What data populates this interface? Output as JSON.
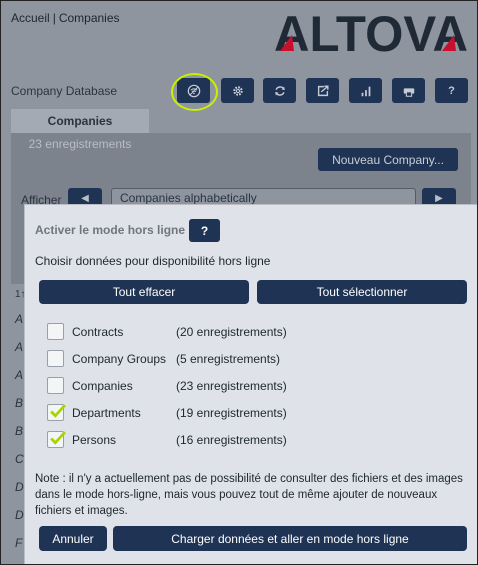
{
  "breadcrumb": {
    "home": "Accueil",
    "separator": "|",
    "current": "Companies"
  },
  "logo": {
    "text": "ALTOVA",
    "accent_color": "#c8102e"
  },
  "page": {
    "title": "Company Database"
  },
  "toolbar": {
    "buttons": [
      {
        "icon": "offline-icon"
      },
      {
        "icon": "gear-icon"
      },
      {
        "icon": "refresh-icon"
      },
      {
        "icon": "export-icon"
      },
      {
        "icon": "chart-icon"
      },
      {
        "icon": "print-icon"
      },
      {
        "icon": "help-icon",
        "label": "?"
      }
    ],
    "highlight_color": "#c8f000"
  },
  "tabs": {
    "active": "Companies",
    "count": "23 enregistrements"
  },
  "actions": {
    "new_company": "Nouveau Company..."
  },
  "view": {
    "label": "Afficher",
    "selected": "Companies alphabetically",
    "prev": "◀",
    "next": "▶"
  },
  "list": {
    "header": "1↑",
    "row_letters": [
      "A",
      "A",
      "A",
      "B",
      "B",
      "C",
      "D",
      "D",
      "F"
    ]
  },
  "modal": {
    "title": "Activer le mode hors ligne",
    "help_label": "?",
    "subtitle": "Choisir données pour disponibilité hors ligne",
    "clear_all": "Tout effacer",
    "select_all": "Tout sélectionner",
    "options": [
      {
        "name": "Contracts",
        "count": "(20 enregistrements)",
        "checked": false
      },
      {
        "name": "Company Groups",
        "count": "(5 enregistrements)",
        "checked": false
      },
      {
        "name": "Companies",
        "count": "(23 enregistrements)",
        "checked": false
      },
      {
        "name": "Departments",
        "count": "(19 enregistrements)",
        "checked": true
      },
      {
        "name": "Persons",
        "count": "(16 enregistrements)",
        "checked": true
      }
    ],
    "note": "Note : il n'y a actuellement pas de possibilité de consulter des fichiers et des images dans le mode hors-ligne, mais vous pouvez tout de même ajouter de nouveaux fichiers et images.",
    "cancel": "Annuler",
    "load": "Charger données et aller en mode hors ligne",
    "check_color": "#a8d400"
  }
}
